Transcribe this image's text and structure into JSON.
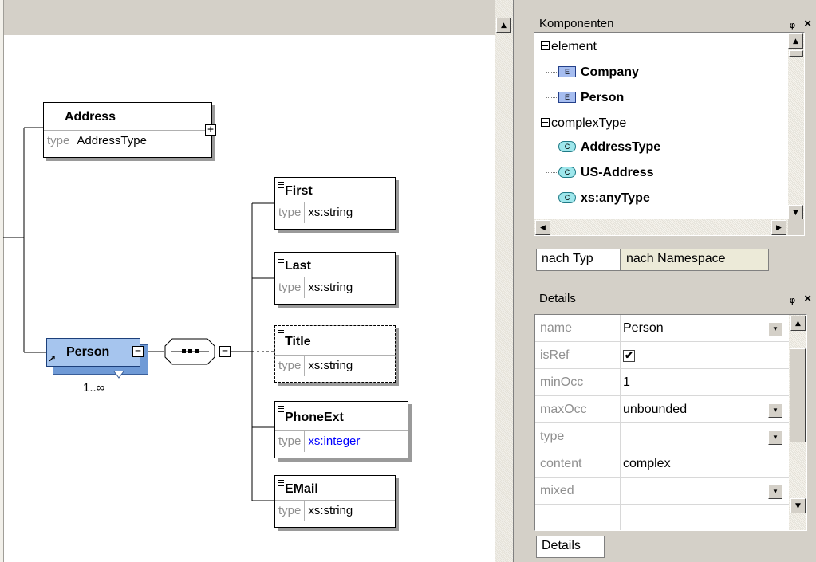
{
  "canvas": {
    "elements": {
      "address": {
        "name": "Address",
        "type_key": "type",
        "type_value": "AddressType"
      },
      "first": {
        "name": "First",
        "type_key": "type",
        "type_value": "xs:string"
      },
      "last": {
        "name": "Last",
        "type_key": "type",
        "type_value": "xs:string"
      },
      "title": {
        "name": "Title",
        "type_key": "type",
        "type_value": "xs:string"
      },
      "phoneext": {
        "name": "PhoneExt",
        "type_key": "type",
        "type_value": "xs:integer"
      },
      "email": {
        "name": "EMail",
        "type_key": "type",
        "type_value": "xs:string"
      }
    },
    "person": {
      "name": "Person",
      "occurrence": "1..∞"
    },
    "sequence_icon": "sequence-compositor-icon",
    "expand_symbol": "+",
    "collapse_symbol": "−",
    "scroll_up_arrow": "▲"
  },
  "components_panel": {
    "title": "Komponenten",
    "pin": "ᵒ⁄",
    "close": "×",
    "tree": {
      "element_group": "element",
      "element_items": [
        "Company",
        "Person"
      ],
      "element_badge": "E",
      "complextype_group": "complexType",
      "complextype_items": [
        "AddressType",
        "US-Address",
        "xs:anyType"
      ],
      "complextype_badge": "C"
    },
    "tabs": [
      "nach Typ",
      "nach Namespace"
    ]
  },
  "details_panel": {
    "title": "Details",
    "rows": [
      {
        "key": "name",
        "value": "Person",
        "dropdown": true
      },
      {
        "key": "isRef",
        "value": "✔",
        "checkbox": true
      },
      {
        "key": "minOcc",
        "value": "1"
      },
      {
        "key": "maxOcc",
        "value": "unbounded",
        "dropdown": true
      },
      {
        "key": "type",
        "value": "",
        "dropdown": true
      },
      {
        "key": "content",
        "value": "complex"
      },
      {
        "key": "mixed",
        "value": "",
        "dropdown": true
      }
    ],
    "tab": "Details"
  },
  "colors": {
    "person_fill": "#a6c5ee",
    "integer_type": "#0000ff",
    "chrome": "#d4d0c8"
  }
}
